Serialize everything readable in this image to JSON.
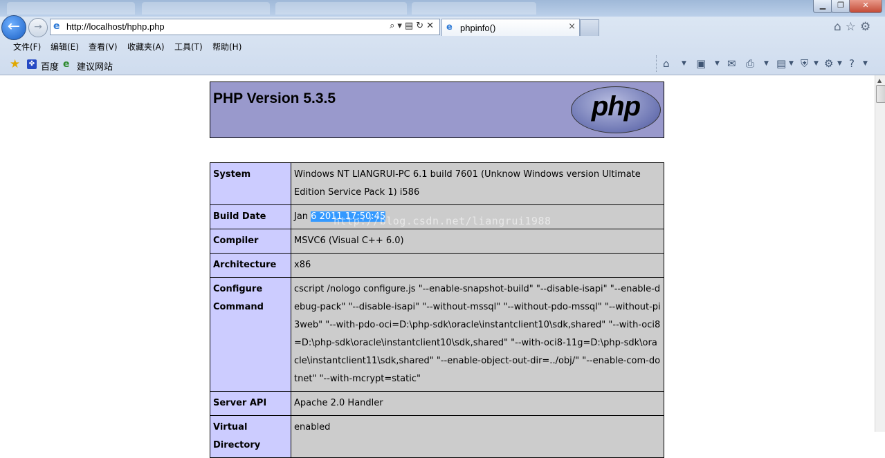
{
  "browser": {
    "address_url": "http://localhost/hphp.php",
    "tab_title": "phpinfo()",
    "tab_close_glyph": "×",
    "icons": [
      "back-arrow-icon",
      "forward-arrow-icon",
      "ie-page-icon",
      "search-icon",
      "compat-view-icon",
      "refresh-icon",
      "stop-icon",
      "home-icon",
      "favorites-star-icon",
      "settings-gear-icon"
    ]
  },
  "menubar": {
    "file": "文件(F)",
    "edit": "编辑(E)",
    "view": "查看(V)",
    "favorites": "收藏夹(A)",
    "tools": "工具(T)",
    "help": "帮助(H)"
  },
  "favbar": {
    "baidu": "百度",
    "suggested": "建议网站"
  },
  "commandbar_icons": [
    "home-icon",
    "rss-feed-icon",
    "read-mail-icon",
    "print-icon",
    "page-icon",
    "safety-icon",
    "tools-icon",
    "help-icon"
  ],
  "phpinfo": {
    "version_title": "PHP Version 5.3.5",
    "logo_text": "php",
    "rows": [
      {
        "key": "System",
        "value": "Windows NT LIANGRUI-PC 6.1 build 7601 (Unknow Windows version Ultimate Edition Service Pack 1) i586"
      },
      {
        "key": "Build Date",
        "value_pre": "Jan ",
        "value_selected": "6 2011 17:50:45"
      },
      {
        "key": "Compiler",
        "value": "MSVC6 (Visual C++ 6.0)"
      },
      {
        "key": "Architecture",
        "value": "x86"
      },
      {
        "key": "Configure Command",
        "value": "cscript /nologo configure.js \"--enable-snapshot-build\" \"--disable-isapi\" \"--enable-debug-pack\" \"--disable-isapi\" \"--without-mssql\" \"--without-pdo-mssql\" \"--without-pi3web\" \"--with-pdo-oci=D:\\php-sdk\\oracle\\instantclient10\\sdk,shared\" \"--with-oci8=D:\\php-sdk\\oracle\\instantclient10\\sdk,shared\" \"--with-oci8-11g=D:\\php-sdk\\oracle\\instantclient11\\sdk,shared\" \"--enable-object-out-dir=../obj/\" \"--enable-com-dotnet\" \"--with-mcrypt=static\""
      },
      {
        "key": "Server API",
        "value": "Apache 2.0 Handler"
      },
      {
        "key": "Virtual Directory",
        "value": "enabled"
      }
    ]
  },
  "watermark": "http://blog.csdn.net/liangrui1988"
}
